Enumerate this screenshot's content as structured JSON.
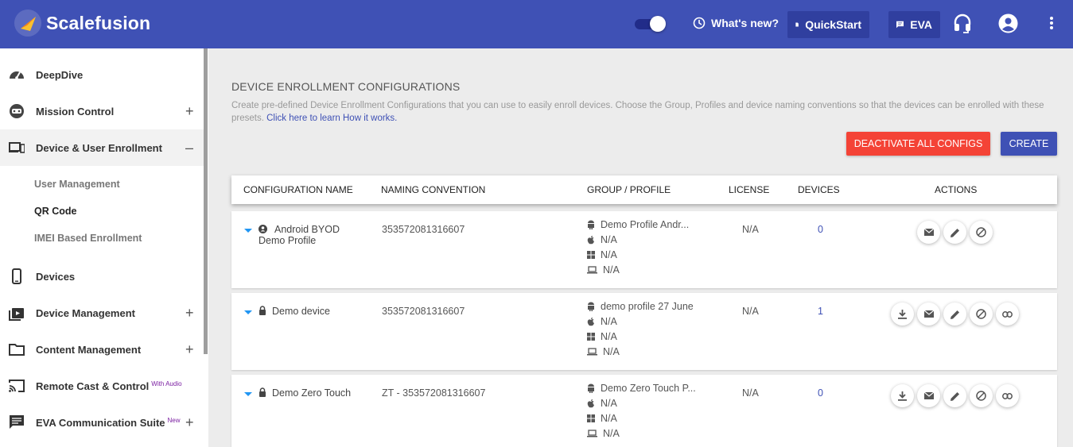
{
  "header": {
    "brand": "Scalefusion",
    "whats_new": "What's new?",
    "quickstart": "QuickStart",
    "eva": "EVA",
    "colors": {
      "bar": "#3f51b5",
      "button": "#303f9f"
    }
  },
  "sidebar": {
    "items": [
      {
        "label": "DeepDive",
        "icon": "speedometer-icon"
      },
      {
        "label": "Mission Control",
        "icon": "control-icon",
        "expand": "+"
      },
      {
        "label": "Device & User Enrollment",
        "icon": "devices-icon",
        "expand": "–"
      },
      {
        "label": "Devices",
        "icon": "phone-icon"
      },
      {
        "label": "Device Management",
        "icon": "media-icon",
        "expand": "+"
      },
      {
        "label": "Content Management",
        "icon": "folder-icon",
        "expand": "+"
      },
      {
        "label": "Remote Cast & Control",
        "icon": "cast-icon",
        "badge": "With Audio"
      },
      {
        "label": "EVA Communication Suite",
        "icon": "chat-icon",
        "badge": "New",
        "expand": "+"
      }
    ],
    "subitems": [
      "User Management",
      "QR Code",
      "IMEI Based Enrollment"
    ]
  },
  "main": {
    "title": "DEVICE ENROLLMENT CONFIGURATIONS",
    "description": "Create pre-defined Device Enrollment Configurations that you can use to easily enroll devices. Choose the Group, Profiles and device naming conventions so that the devices can be enrolled with these presets.",
    "learn_link": "Click here to learn How it works.",
    "deactivate_button": "DEACTIVATE ALL CONFIGS",
    "create_button": "CREATE",
    "colors": {
      "deactivate": "#f44336",
      "create": "#3f51b5"
    }
  },
  "table": {
    "headers": [
      "CONFIGURATION NAME",
      "NAMING CONVENTION",
      "GROUP / PROFILE",
      "LICENSE",
      "DEVICES",
      "ACTIONS"
    ],
    "rows": [
      {
        "name": "Android BYOD Demo Profile",
        "naming": "353572081316607",
        "android": "Demo Profile Andr...",
        "ios": "N/A",
        "windows": "N/A",
        "mac": "N/A",
        "license": "N/A",
        "devices": "0"
      },
      {
        "name": "Demo device",
        "naming": "353572081316607",
        "android": "demo profile 27 June",
        "ios": "N/A",
        "windows": "N/A",
        "mac": "N/A",
        "license": "N/A",
        "devices": "1"
      },
      {
        "name": "Demo Zero Touch",
        "naming": "ZT - 353572081316607",
        "android": "Demo Zero Touch P...",
        "ios": "N/A",
        "windows": "N/A",
        "mac": "N/A",
        "license": "N/A",
        "devices": "0"
      }
    ]
  }
}
